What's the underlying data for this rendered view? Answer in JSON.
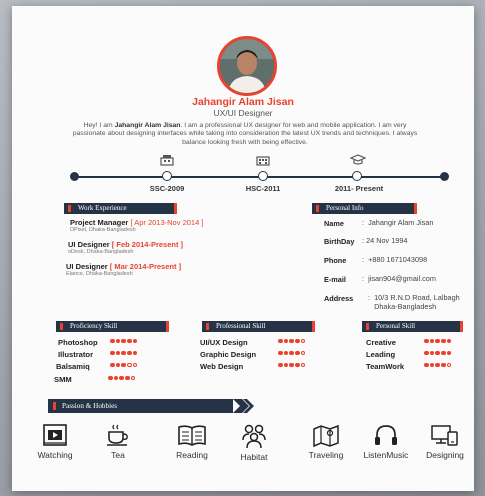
{
  "profile": {
    "name": "Jahangir Alam Jisan",
    "role": "UX/UI Designer",
    "bio_pre": "Hey! I am ",
    "bio_name": "Jahangir Alam Jisan",
    "bio_post": ". I am a professional UX designer for web and mobile application. I am very passionate about designing interfaces while taking into consideration the latest UX trends and techniques. I always balance looking fresh with being effective."
  },
  "timeline": [
    {
      "label": "SSC-2009",
      "icon": "school-icon"
    },
    {
      "label": "HSC-2011",
      "icon": "college-icon"
    },
    {
      "label": "2011- Present",
      "icon": "graduation-cap-icon"
    }
  ],
  "work": {
    "heading": "Work Experience",
    "jobs": [
      {
        "title": "Project Manager",
        "date": "[ Apr 2013-Nov 2014 ]",
        "company": "DPixel, Dhaka-Bangladesh"
      },
      {
        "title": "UI Designer",
        "date": "[ Feb 2014-Present ]",
        "company": "oDesk, Dhaka-Bangladesh"
      },
      {
        "title": "UI Designer",
        "date": "[ Mar 2014-Present ]",
        "company": "Elance, Dhaka-Bangladesh"
      }
    ]
  },
  "personal": {
    "heading": "Personal Info",
    "rows": [
      {
        "label": "Name",
        "value": "Jahangir Alam Jisan"
      },
      {
        "label": "BirthDay",
        "value": "24 Nov 1994"
      },
      {
        "label": "Phone",
        "value": "+880 1671043098"
      },
      {
        "label": "E-mail",
        "value": "jisan904@gmail.com"
      },
      {
        "label": "Address",
        "value": "10/3 R.N.D Road, Lalbagh",
        "value2": "Dhaka-Bangladesh"
      }
    ]
  },
  "skills": [
    {
      "heading": "Proficiency Skill",
      "items": [
        {
          "name": "Photoshop",
          "level": 5
        },
        {
          "name": "Illustrator",
          "level": 5
        },
        {
          "name": "Balsamiq",
          "level": 3
        },
        {
          "name": "SMM",
          "level": 4
        }
      ]
    },
    {
      "heading": "Professional Skill",
      "items": [
        {
          "name": "UI/UX Design",
          "level": 4
        },
        {
          "name": "Graphic Design",
          "level": 4
        },
        {
          "name": "Web Design",
          "level": 4
        }
      ]
    },
    {
      "heading": "Personal Skill",
      "items": [
        {
          "name": "Creative",
          "level": 5
        },
        {
          "name": "Leading",
          "level": 5
        },
        {
          "name": "TeamWork",
          "level": 4
        }
      ]
    }
  ],
  "hobbies": {
    "heading": "Passion & Hobbies",
    "items": [
      {
        "label": "Watching",
        "icon": "video-icon"
      },
      {
        "label": "Tea",
        "icon": "tea-cup-icon"
      },
      {
        "label": "Reading",
        "icon": "book-icon"
      },
      {
        "label": "Habitat",
        "icon": "people-icon"
      },
      {
        "label": "Traveling",
        "icon": "map-icon"
      },
      {
        "label": "ListenMusic",
        "icon": "headphones-icon"
      },
      {
        "label": "Designing",
        "icon": "devices-icon"
      }
    ]
  },
  "colors": {
    "accent": "#e8432f",
    "navy": "#263347"
  }
}
